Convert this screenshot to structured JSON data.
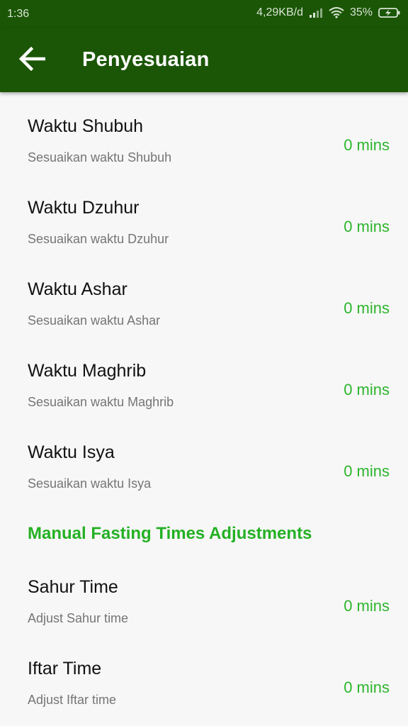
{
  "status_bar": {
    "time": "1:36",
    "network_speed": "4,29KB/d",
    "battery": "35%",
    "icons": [
      "signal-icon",
      "wifi-icon",
      "battery-charging-icon"
    ]
  },
  "app_bar": {
    "title": "Penyesuaian",
    "back_icon": "arrow-back-icon"
  },
  "prayer_adjustments": [
    {
      "title": "Waktu Shubuh",
      "summary": "Sesuaikan waktu Shubuh",
      "value": "0 mins"
    },
    {
      "title": "Waktu Dzuhur",
      "summary": "Sesuaikan waktu Dzuhur",
      "value": "0 mins"
    },
    {
      "title": "Waktu Ashar",
      "summary": "Sesuaikan waktu Ashar",
      "value": "0 mins"
    },
    {
      "title": "Waktu Maghrib",
      "summary": "Sesuaikan waktu Maghrib",
      "value": "0 mins"
    },
    {
      "title": "Waktu Isya",
      "summary": "Sesuaikan waktu Isya",
      "value": "0 mins"
    }
  ],
  "fasting_section": {
    "header": "Manual Fasting Times Adjustments",
    "items": [
      {
        "title": "Sahur Time",
        "summary": "Adjust Sahur time",
        "value": "0 mins"
      },
      {
        "title": "Iftar Time",
        "summary": "Adjust Iftar time",
        "value": "0 mins"
      }
    ]
  },
  "colors": {
    "app_bar": "#1b5606",
    "accent": "#2db52d",
    "background": "#f7f7f7"
  }
}
